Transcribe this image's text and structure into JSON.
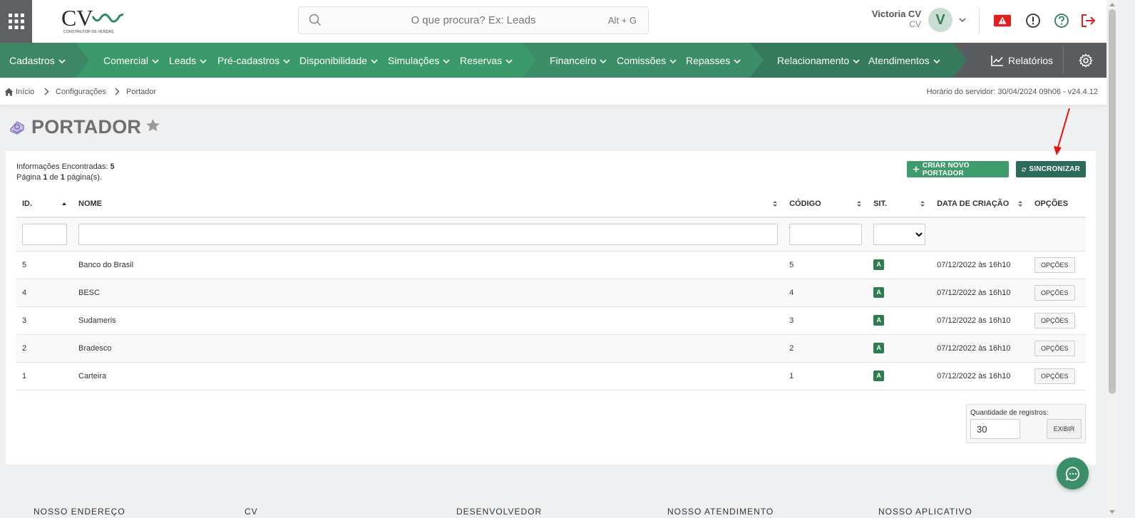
{
  "header": {
    "logo_text": "CV",
    "logo_tagline": "CONSTRUTOR DE VENDAS",
    "search_placeholder": "O que procura? Ex: Leads",
    "search_shortcut": "Alt + G",
    "user_name": "Victoria CV",
    "user_org": "CV",
    "avatar_letter": "V"
  },
  "nav": {
    "items": [
      "Cadastros",
      "Comercial",
      "Leads",
      "Pré-cadastros",
      "Disponibilidade",
      "Simulações",
      "Reservas",
      "Financeiro",
      "Comissões",
      "Repasses",
      "Relacionamento",
      "Atendimentos"
    ],
    "reports_label": "Relatórios"
  },
  "breadcrumb": {
    "items": [
      "Início",
      "Configurações",
      "Portador"
    ],
    "server_time": "Horário do servidor: 30/04/2024 09h06 - v24.4.12"
  },
  "page": {
    "title": "PORTADOR"
  },
  "panel": {
    "found_label": "Informações Encontradas:",
    "found_count": "5",
    "page_word": "Página",
    "page_current": "1",
    "page_of": "de",
    "page_total": "1",
    "page_suffix": "página(s).",
    "create_button": "CRIAR NOVO PORTADOR",
    "sync_button": "SINCRONIZAR"
  },
  "table": {
    "columns": [
      "ID.",
      "NOME",
      "CÓDIGO",
      "SIT.",
      "DATA DE CRIAÇÃO",
      "OPÇÕES"
    ],
    "rows": [
      {
        "id": "5",
        "nome": "Banco do Brasil",
        "codigo": "5",
        "sit": "A",
        "data": "07/12/2022 às 16h10",
        "opcoes": "OPÇÕES"
      },
      {
        "id": "4",
        "nome": "BESC",
        "codigo": "4",
        "sit": "A",
        "data": "07/12/2022 às 16h10",
        "opcoes": "OPÇÕES"
      },
      {
        "id": "3",
        "nome": "Sudameris",
        "codigo": "3",
        "sit": "A",
        "data": "07/12/2022 às 16h10",
        "opcoes": "OPÇÕES"
      },
      {
        "id": "2",
        "nome": "Bradesco",
        "codigo": "2",
        "sit": "A",
        "data": "07/12/2022 às 16h10",
        "opcoes": "OPÇÕES"
      },
      {
        "id": "1",
        "nome": "Carteira",
        "codigo": "1",
        "sit": "A",
        "data": "07/12/2022 às 16h10",
        "opcoes": "OPÇÕES"
      }
    ]
  },
  "pagination": {
    "qty_label": "Quantidade de registros:",
    "qty_value": "30",
    "show_button": "EXIBIR"
  },
  "footer": {
    "columns": [
      "NOSSO ENDEREÇO",
      "CV",
      "DESENVOLVEDOR",
      "NOSSO ATENDIMENTO",
      "NOSSO APLICATIVO"
    ]
  },
  "colors": {
    "nav_green": "#3b7a5e",
    "create_green": "#3f9a6c",
    "sync_teal": "#2c6a5a",
    "status_active": "#2e7d4f",
    "alert_red": "#e02020",
    "annotation_arrow": "#e81010"
  },
  "icons": [
    "apps-grid-icon",
    "search-icon",
    "chevron-down-icon",
    "alert-icon",
    "info-icon",
    "help-icon",
    "logout-icon",
    "chart-icon",
    "gear-icon",
    "home-icon",
    "chevron-right-icon",
    "portador-icon",
    "star-icon",
    "plus-icon",
    "refresh-icon",
    "sort-icon",
    "chat-icon"
  ]
}
